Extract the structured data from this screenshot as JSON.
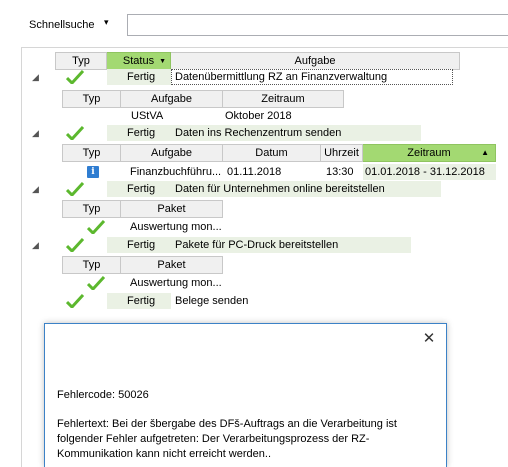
{
  "search": {
    "label": "Schnellsuche",
    "dropdown_icon": "▾",
    "value": "",
    "placeholder": ""
  },
  "grid": {
    "columns": {
      "typ": "Typ",
      "status": "Status",
      "aufgabe": "Aufgabe"
    },
    "sorted_column": "Status",
    "rows": [
      {
        "status": "Fertig",
        "task": "Datenübermittlung RZ an Finanzverwaltung",
        "detail_headers": [
          "Typ",
          "Aufgabe",
          "Zeitraum"
        ],
        "detail_row": [
          "",
          "UStVA",
          "Oktober 2018"
        ]
      },
      {
        "status": "Fertig",
        "task": "Daten ins Rechenzentrum senden",
        "detail_headers": [
          "Typ",
          "Aufgabe",
          "Datum",
          "Uhrzeit",
          "Zeitraum"
        ],
        "detail_row": [
          "i",
          "Finanzbuchführu...",
          "01.11.2018",
          "13:30",
          "01.01.2018 - 31.12.2018"
        ]
      },
      {
        "status": "Fertig",
        "task": "Daten für Unternehmen online bereitstellen",
        "detail_headers": [
          "Typ",
          "Paket"
        ],
        "detail_row": [
          "",
          "Auswertung  mon..."
        ]
      },
      {
        "status": "Fertig",
        "task": "Pakete für PC-Druck bereitstellen",
        "detail_headers": [
          "Typ",
          "Paket"
        ],
        "detail_row": [
          "",
          "Auswertung  mon..."
        ]
      },
      {
        "status": "Fertig",
        "task": "Belege senden"
      }
    ]
  },
  "dialog": {
    "close_label": "✕",
    "error_code": "Fehlercode: 50026",
    "error_text": "Fehlertext: Bei der šbergabe des DFš-Auftrags an die Verarbeitung ist folgender Fehler aufgetreten: Der Verarbeitungsprozess der RZ-Kommunikation kann nicht erreicht werden.."
  },
  "colors": {
    "status_active_header": "#a3d972",
    "status_cell_bg": "#eaf1e4",
    "check_green": "#5cb82e",
    "dialog_border": "#3c82c7"
  }
}
